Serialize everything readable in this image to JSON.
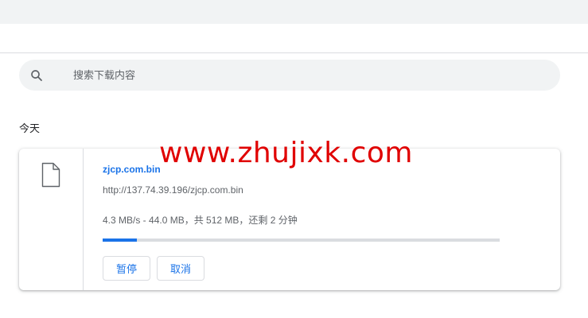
{
  "search": {
    "placeholder": "搜索下载内容",
    "icon": "search-icon"
  },
  "downloads": {
    "section_title": "今天",
    "items": [
      {
        "icon": "file-icon",
        "file_name": "zjcp.com.bin",
        "url": "http://137.74.39.196/zjcp.com.bin",
        "status": "4.3 MB/s - 44.0 MB，共 512 MB，还剩 2 分钟",
        "progress": 0.086,
        "pause_label": "暂停",
        "cancel_label": "取消"
      }
    ]
  },
  "watermark": {
    "text": "www.zhujixk.com"
  },
  "colors": {
    "accent": "#1a73e8",
    "top_bar": "#f1f3f4",
    "search_bg": "#f1f3f4",
    "progress_track": "#dadce0",
    "watermark": "#e00000"
  }
}
